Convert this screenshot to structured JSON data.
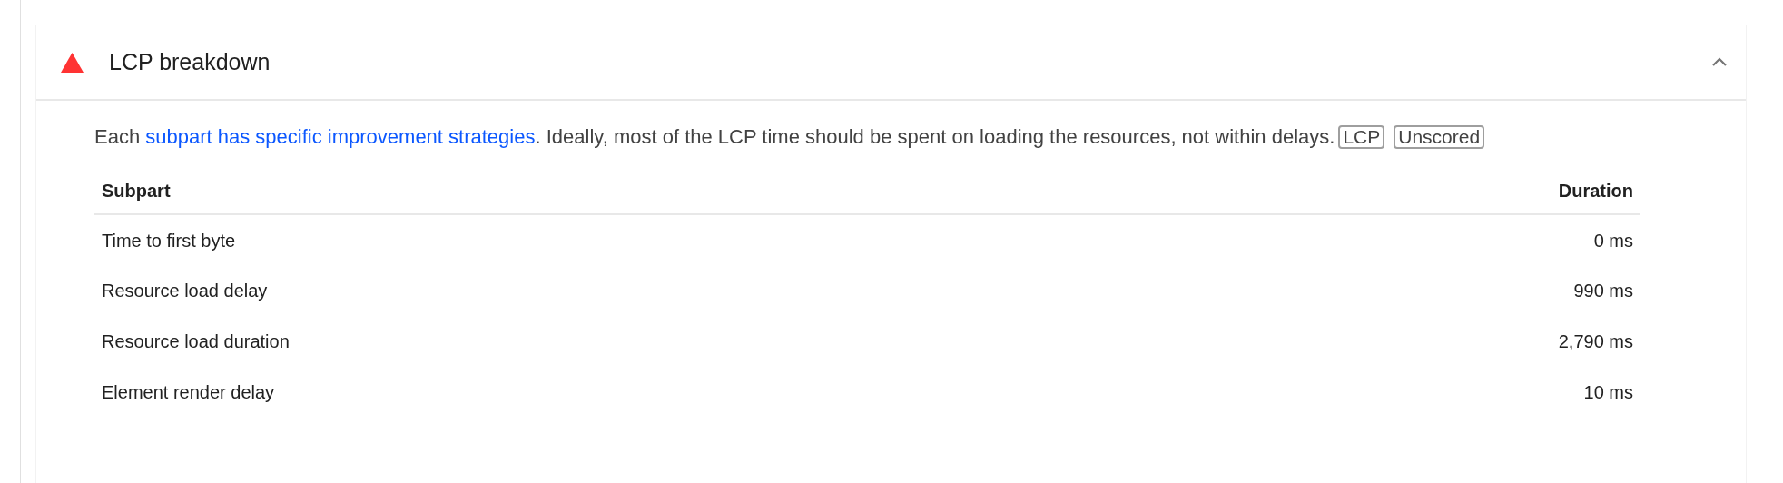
{
  "audit": {
    "title": "LCP breakdown",
    "failing": true,
    "expanded": true,
    "description_parts": [
      {
        "kind": "text",
        "text": "Each "
      },
      {
        "kind": "link",
        "text": "subpart has specific improvement strategies"
      },
      {
        "kind": "text",
        "text": ". Ideally, most of the LCP time should be spent on loading the resources, not within delays."
      }
    ],
    "tags": [
      "LCP",
      "Unscored"
    ],
    "table": {
      "columns": [
        "Subpart",
        "Duration"
      ],
      "rows": [
        [
          "Time to first byte",
          "0 ms"
        ],
        [
          "Resource load delay",
          "990 ms"
        ],
        [
          "Resource load duration",
          "2,790 ms"
        ],
        [
          "Element render delay",
          "10 ms"
        ]
      ]
    }
  }
}
